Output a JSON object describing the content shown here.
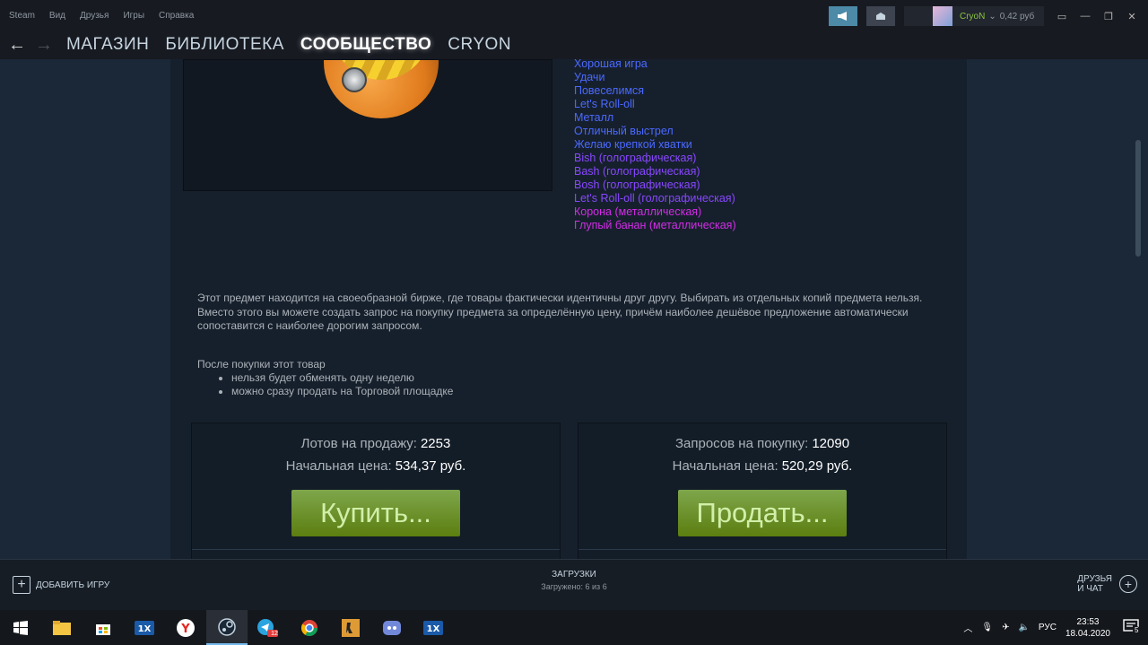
{
  "titlebar": {
    "menu": [
      "Steam",
      "Вид",
      "Друзья",
      "Игры",
      "Справка"
    ],
    "user_name": "CryoN",
    "user_balance": "0,42 руб"
  },
  "nav": {
    "back": "←",
    "forward": "→",
    "links": [
      "МАГАЗИН",
      "БИБЛИОТЕКА",
      "СООБЩЕСТВО",
      "CRYON"
    ]
  },
  "stickers": [
    {
      "text": "Хорошая игра",
      "rarity": "blue"
    },
    {
      "text": "Удачи",
      "rarity": "blue"
    },
    {
      "text": "Повеселимся",
      "rarity": "blue"
    },
    {
      "text": "Let's Roll-oll",
      "rarity": "blue"
    },
    {
      "text": "Металл",
      "rarity": "blue"
    },
    {
      "text": "Отличный выстрел",
      "rarity": "blue"
    },
    {
      "text": "Желаю крепкой хватки",
      "rarity": "blue"
    },
    {
      "text": "Bish (голографическая)",
      "rarity": "purple"
    },
    {
      "text": "Bash (голографическая)",
      "rarity": "purple"
    },
    {
      "text": "Bosh (голографическая)",
      "rarity": "purple"
    },
    {
      "text": "Let's Roll-oll (голографическая)",
      "rarity": "purple"
    },
    {
      "text": "Корона (металлическая)",
      "rarity": "pink"
    },
    {
      "text": "Глупый банан (металлическая)",
      "rarity": "pink"
    }
  ],
  "rarity_colors": {
    "blue": "#4b69ff",
    "purple": "#8847ff",
    "pink": "#d32ce6"
  },
  "description": "Этот предмет находится на своеобразной бирже, где товары фактически идентичны друг другу. Выбирать из отдельных копий предмета нельзя. Вместо этого вы можете создать запрос на покупку предмета за определённую цену, причём наиболее дешёвое предложение автоматически сопоставится с наиболее дорогим запросом.",
  "after_purchase": {
    "title": "После покупки этот товар",
    "items": [
      "нельзя будет обменять одну неделю",
      "можно сразу продать на Торговой площадке"
    ]
  },
  "buy": {
    "lots_label": "Лотов на продажу:",
    "lots_value": "2253",
    "price_label": "Начальная цена:",
    "price_value": "534,37 руб.",
    "button": "Купить..."
  },
  "sell": {
    "requests_label": "Запросов на покупку:",
    "requests_value": "12090",
    "price_label": "Начальная цена:",
    "price_value": "520,29 руб.",
    "button": "Продать..."
  },
  "bottom": {
    "add_game": "ДОБАВИТЬ ИГРУ",
    "downloads_title": "ЗАГРУЗКИ",
    "downloads_sub": "Загружено: 6 из 6",
    "friends_line1": "ДРУЗЬЯ",
    "friends_line2": "И ЧАТ"
  },
  "taskbar": {
    "icons": [
      "windows-start-icon",
      "file-explorer-icon",
      "store-icon",
      "1xbet-icon",
      "yandex-browser-icon",
      "steam-icon",
      "telegram-icon",
      "chrome-icon",
      "counter-strike-icon",
      "discord-icon",
      "1xbet-icon-2"
    ],
    "lang": "РУС",
    "time": "23:53",
    "date": "18.04.2020",
    "notifications": "5",
    "telegram_badge": "12"
  }
}
